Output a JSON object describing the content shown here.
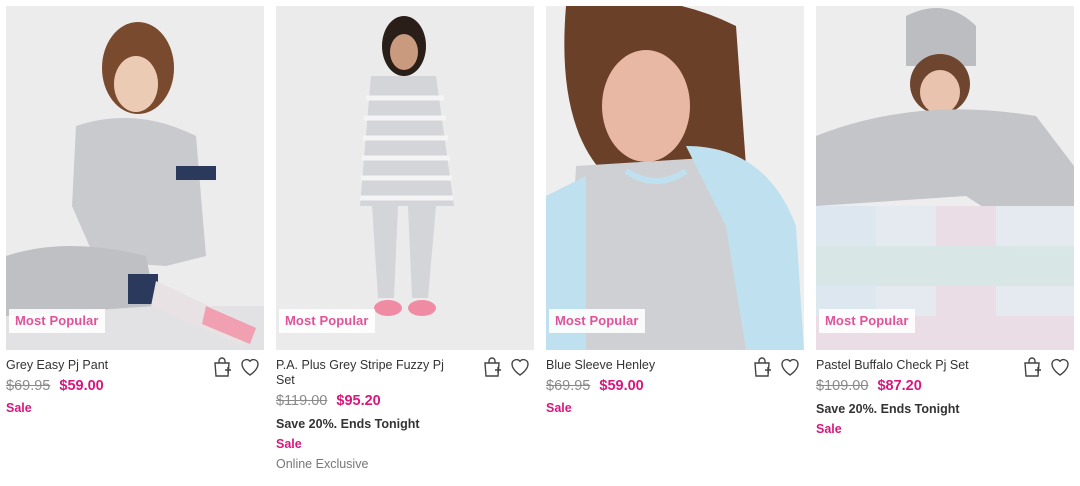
{
  "products": [
    {
      "badge": "Most Popular",
      "name": "Grey Easy Pj Pant",
      "was_price": "$69.95",
      "price": "$59.00",
      "promo": "",
      "sale_label": "Sale",
      "exclusive": "",
      "image_palette": {
        "bg": "#ececed",
        "garment": "#c9cacd",
        "accent": "#2b3a5c",
        "sock": "#f0a0b0",
        "hair": "#7a4a2e"
      },
      "icons": [
        "add-to-bag-icon",
        "heart-icon"
      ]
    },
    {
      "badge": "Most Popular",
      "name": "P.A. Plus Grey Stripe Fuzzy Pj Set",
      "was_price": "$119.00",
      "price": "$95.20",
      "promo": "Save 20%. Ends Tonight",
      "sale_label": "Sale",
      "exclusive": "Online Exclusive",
      "image_palette": {
        "bg": "#ebebec",
        "garment": "#d4d5d8",
        "accent": "#f7f7f7",
        "sock": "#f08ba4",
        "hair": "#2a1e18"
      },
      "icons": [
        "add-to-bag-icon",
        "heart-icon"
      ]
    },
    {
      "badge": "Most Popular",
      "name": "Blue Sleeve Henley",
      "was_price": "$69.95",
      "price": "$59.00",
      "promo": "",
      "sale_label": "Sale",
      "exclusive": "",
      "image_palette": {
        "bg": "#eeeeef",
        "garment": "#cfd0d3",
        "accent": "#bfe1ef",
        "sock": "#e8b8a4",
        "hair": "#6b4028"
      },
      "icons": [
        "add-to-bag-icon",
        "heart-icon"
      ]
    },
    {
      "badge": "Most Popular",
      "name": "Pastel Buffalo Check Pj Set",
      "was_price": "$109.00",
      "price": "$87.20",
      "promo": "Save 20%. Ends Tonight",
      "sale_label": "Sale",
      "exclusive": "",
      "image_palette": {
        "bg": "#ededee",
        "garment": "#c4c5c8",
        "accent": "#d9e6ef",
        "sock": "#f2d3dd",
        "hair": "#6e4630"
      },
      "icons": [
        "add-to-bag-icon",
        "heart-icon"
      ]
    }
  ]
}
